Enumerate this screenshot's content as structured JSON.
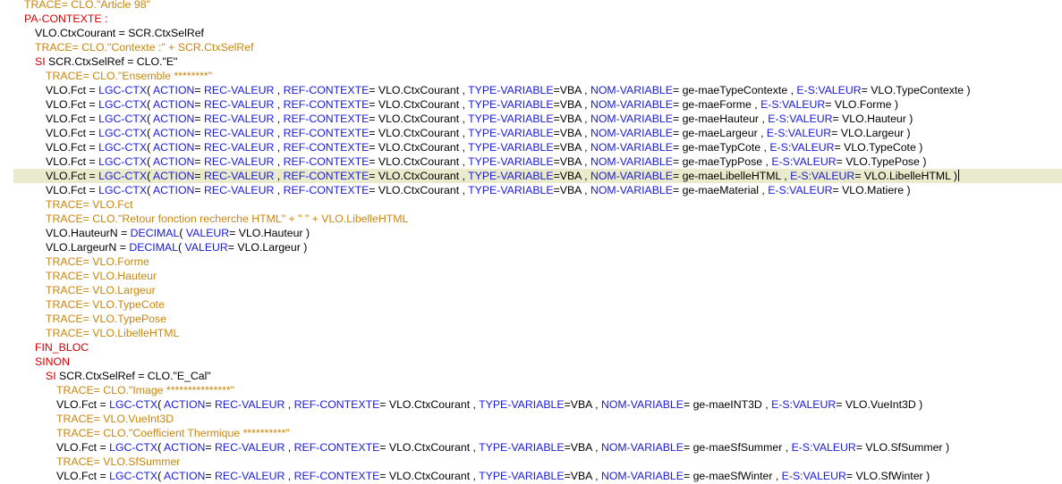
{
  "editor": {
    "current_line_index": 12,
    "lines": [
      {
        "indent": 27,
        "tokens": [
          [
            "tr",
            "TRACE= CLO.\"Article 98\""
          ]
        ]
      },
      {
        "indent": 27,
        "tokens": [
          [
            "rd",
            "PA-CONTEXTE :"
          ]
        ]
      },
      {
        "indent": 39,
        "tokens": [
          [
            "b",
            "VLO.CtxCourant = SCR.CtxSelRef"
          ]
        ]
      },
      {
        "indent": 39,
        "tokens": [
          [
            "tr",
            "TRACE= CLO.\"Contexte :\" + SCR.CtxSelRef"
          ]
        ]
      },
      {
        "indent": 39,
        "tokens": [
          [
            "rd",
            "SI "
          ],
          [
            "b",
            "SCR.CtxSelRef = CLO.\"E\""
          ]
        ]
      },
      {
        "indent": 51,
        "tokens": [
          [
            "tr",
            "TRACE= CLO.\"Ensemble ********\""
          ]
        ]
      },
      {
        "indent": 51,
        "tokens": [
          [
            "b",
            "VLO.Fct = "
          ],
          [
            "fn",
            "LGC-CTX"
          ],
          [
            "b",
            "( "
          ],
          [
            "kw",
            "ACTION"
          ],
          [
            "b",
            "= "
          ],
          [
            "kw",
            "REC-VALEUR"
          ],
          [
            "b",
            " , "
          ],
          [
            "kw",
            "REF-CONTEXTE"
          ],
          [
            "b",
            "= VLO.CtxCourant , "
          ],
          [
            "kw",
            "TYPE-VARIABLE"
          ],
          [
            "b",
            "=VBA , "
          ],
          [
            "kw",
            "NOM-VARIABLE"
          ],
          [
            "b",
            "= ge-maeTypeContexte , "
          ],
          [
            "kw",
            "E-S:VALEUR"
          ],
          [
            "b",
            "= VLO.TypeContexte )"
          ]
        ]
      },
      {
        "indent": 51,
        "tokens": [
          [
            "b",
            "VLO.Fct = "
          ],
          [
            "fn",
            "LGC-CTX"
          ],
          [
            "b",
            "( "
          ],
          [
            "kw",
            "ACTION"
          ],
          [
            "b",
            "= "
          ],
          [
            "kw",
            "REC-VALEUR"
          ],
          [
            "b",
            " , "
          ],
          [
            "kw",
            "REF-CONTEXTE"
          ],
          [
            "b",
            "= VLO.CtxCourant , "
          ],
          [
            "kw",
            "TYPE-VARIABLE"
          ],
          [
            "b",
            "=VBA , "
          ],
          [
            "kw",
            "NOM-VARIABLE"
          ],
          [
            "b",
            "= ge-maeForme , "
          ],
          [
            "kw",
            "E-S:VALEUR"
          ],
          [
            "b",
            "= VLO.Forme )"
          ]
        ]
      },
      {
        "indent": 51,
        "tokens": [
          [
            "b",
            "VLO.Fct = "
          ],
          [
            "fn",
            "LGC-CTX"
          ],
          [
            "b",
            "( "
          ],
          [
            "kw",
            "ACTION"
          ],
          [
            "b",
            "= "
          ],
          [
            "kw",
            "REC-VALEUR"
          ],
          [
            "b",
            " , "
          ],
          [
            "kw",
            "REF-CONTEXTE"
          ],
          [
            "b",
            "= VLO.CtxCourant , "
          ],
          [
            "kw",
            "TYPE-VARIABLE"
          ],
          [
            "b",
            "=VBA , "
          ],
          [
            "kw",
            "NOM-VARIABLE"
          ],
          [
            "b",
            "= ge-maeHauteur , "
          ],
          [
            "kw",
            "E-S:VALEUR"
          ],
          [
            "b",
            "= VLO.Hauteur )"
          ]
        ]
      },
      {
        "indent": 51,
        "tokens": [
          [
            "b",
            "VLO.Fct = "
          ],
          [
            "fn",
            "LGC-CTX"
          ],
          [
            "b",
            "( "
          ],
          [
            "kw",
            "ACTION"
          ],
          [
            "b",
            "= "
          ],
          [
            "kw",
            "REC-VALEUR"
          ],
          [
            "b",
            " , "
          ],
          [
            "kw",
            "REF-CONTEXTE"
          ],
          [
            "b",
            "= VLO.CtxCourant , "
          ],
          [
            "kw",
            "TYPE-VARIABLE"
          ],
          [
            "b",
            "=VBA , "
          ],
          [
            "kw",
            "NOM-VARIABLE"
          ],
          [
            "b",
            "= ge-maeLargeur , "
          ],
          [
            "kw",
            "E-S:VALEUR"
          ],
          [
            "b",
            "= VLO.Largeur )"
          ]
        ]
      },
      {
        "indent": 51,
        "tokens": [
          [
            "b",
            "VLO.Fct = "
          ],
          [
            "fn",
            "LGC-CTX"
          ],
          [
            "b",
            "( "
          ],
          [
            "kw",
            "ACTION"
          ],
          [
            "b",
            "= "
          ],
          [
            "kw",
            "REC-VALEUR"
          ],
          [
            "b",
            " , "
          ],
          [
            "kw",
            "REF-CONTEXTE"
          ],
          [
            "b",
            "= VLO.CtxCourant , "
          ],
          [
            "kw",
            "TYPE-VARIABLE"
          ],
          [
            "b",
            "=VBA , "
          ],
          [
            "kw",
            "NOM-VARIABLE"
          ],
          [
            "b",
            "= ge-maeTypCote , "
          ],
          [
            "kw",
            "E-S:VALEUR"
          ],
          [
            "b",
            "= VLO.TypeCote )"
          ]
        ]
      },
      {
        "indent": 51,
        "tokens": [
          [
            "b",
            "VLO.Fct = "
          ],
          [
            "fn",
            "LGC-CTX"
          ],
          [
            "b",
            "( "
          ],
          [
            "kw",
            "ACTION"
          ],
          [
            "b",
            "= "
          ],
          [
            "kw",
            "REC-VALEUR"
          ],
          [
            "b",
            " , "
          ],
          [
            "kw",
            "REF-CONTEXTE"
          ],
          [
            "b",
            "= VLO.CtxCourant , "
          ],
          [
            "kw",
            "TYPE-VARIABLE"
          ],
          [
            "b",
            "=VBA , "
          ],
          [
            "kw",
            "NOM-VARIABLE"
          ],
          [
            "b",
            "= ge-maeTypPose , "
          ],
          [
            "kw",
            "E-S:VALEUR"
          ],
          [
            "b",
            "= VLO.TypePose )"
          ]
        ]
      },
      {
        "indent": 51,
        "tokens": [
          [
            "b",
            "VLO.Fct = "
          ],
          [
            "fn",
            "LGC-CTX"
          ],
          [
            "b",
            "( "
          ],
          [
            "kw",
            "ACTION"
          ],
          [
            "b",
            "= "
          ],
          [
            "kw",
            "REC-VALEUR"
          ],
          [
            "b",
            " , "
          ],
          [
            "kw",
            "REF-CONTEXTE"
          ],
          [
            "b",
            "= VLO.CtxCourant , "
          ],
          [
            "kw",
            "TYPE-VARIABLE"
          ],
          [
            "b",
            "=VBA , "
          ],
          [
            "kw",
            "NOM-VARIABLE"
          ],
          [
            "b",
            "= ge-maeLibelleHTML , "
          ],
          [
            "kw",
            "E-S:VALEUR"
          ],
          [
            "b",
            "= VLO.LibelleHTML )"
          ]
        ]
      },
      {
        "indent": 51,
        "tokens": [
          [
            "b",
            "VLO.Fct = "
          ],
          [
            "fn",
            "LGC-CTX"
          ],
          [
            "b",
            "( "
          ],
          [
            "kw",
            "ACTION"
          ],
          [
            "b",
            "= "
          ],
          [
            "kw",
            "REC-VALEUR"
          ],
          [
            "b",
            " , "
          ],
          [
            "kw",
            "REF-CONTEXTE"
          ],
          [
            "b",
            "= VLO.CtxCourant , "
          ],
          [
            "kw",
            "TYPE-VARIABLE"
          ],
          [
            "b",
            "=VBA , "
          ],
          [
            "kw",
            "NOM-VARIABLE"
          ],
          [
            "b",
            "= ge-maeMaterial , "
          ],
          [
            "kw",
            "E-S:VALEUR"
          ],
          [
            "b",
            "= VLO.Matiere )"
          ]
        ]
      },
      {
        "indent": 51,
        "tokens": [
          [
            "tr",
            "TRACE= VLO.Fct"
          ]
        ]
      },
      {
        "indent": 51,
        "tokens": [
          [
            "tr",
            "TRACE= CLO.\"Retour fonction recherche HTML\" + \" \" + VLO.LibelleHTML"
          ]
        ]
      },
      {
        "indent": 51,
        "tokens": [
          [
            "b",
            "VLO.HauteurN = "
          ],
          [
            "fn",
            "DECIMAL"
          ],
          [
            "b",
            "( "
          ],
          [
            "kw",
            "VALEUR"
          ],
          [
            "b",
            "= VLO.Hauteur )"
          ]
        ]
      },
      {
        "indent": 51,
        "tokens": [
          [
            "b",
            "VLO.LargeurN = "
          ],
          [
            "fn",
            "DECIMAL"
          ],
          [
            "b",
            "( "
          ],
          [
            "kw",
            "VALEUR"
          ],
          [
            "b",
            "= VLO.Largeur )"
          ]
        ]
      },
      {
        "indent": 51,
        "tokens": [
          [
            "tr",
            "TRACE= VLO.Forme"
          ]
        ]
      },
      {
        "indent": 51,
        "tokens": [
          [
            "tr",
            "TRACE= VLO.Hauteur"
          ]
        ]
      },
      {
        "indent": 51,
        "tokens": [
          [
            "tr",
            "TRACE= VLO.Largeur"
          ]
        ]
      },
      {
        "indent": 51,
        "tokens": [
          [
            "tr",
            "TRACE= VLO.TypeCote"
          ]
        ]
      },
      {
        "indent": 51,
        "tokens": [
          [
            "tr",
            "TRACE= VLO.TypePose"
          ]
        ]
      },
      {
        "indent": 51,
        "tokens": [
          [
            "tr",
            "TRACE= VLO.LibelleHTML"
          ]
        ]
      },
      {
        "indent": 39,
        "tokens": [
          [
            "rd",
            "FIN_BLOC"
          ]
        ]
      },
      {
        "indent": 39,
        "tokens": [
          [
            "rd",
            "SINON"
          ]
        ]
      },
      {
        "indent": 51,
        "tokens": [
          [
            "rd",
            "SI "
          ],
          [
            "b",
            "SCR.CtxSelRef = CLO.\"E_Cal\""
          ]
        ]
      },
      {
        "indent": 63,
        "tokens": [
          [
            "tr",
            "TRACE= CLO.\"Image ***************\""
          ]
        ]
      },
      {
        "indent": 63,
        "tokens": [
          [
            "b",
            "VLO.Fct = "
          ],
          [
            "fn",
            "LGC-CTX"
          ],
          [
            "b",
            "( "
          ],
          [
            "kw",
            "ACTION"
          ],
          [
            "b",
            "= "
          ],
          [
            "kw",
            "REC-VALEUR"
          ],
          [
            "b",
            " , "
          ],
          [
            "kw",
            "REF-CONTEXTE"
          ],
          [
            "b",
            "= VLO.CtxCourant , "
          ],
          [
            "kw",
            "TYPE-VARIABLE"
          ],
          [
            "b",
            "=VBA , "
          ],
          [
            "kw",
            "NOM-VARIABLE"
          ],
          [
            "b",
            "= ge-maeINT3D , "
          ],
          [
            "kw",
            "E-S:VALEUR"
          ],
          [
            "b",
            "= VLO.VueInt3D )"
          ]
        ]
      },
      {
        "indent": 63,
        "tokens": [
          [
            "tr",
            "TRACE= VLO.VueInt3D"
          ]
        ]
      },
      {
        "indent": 63,
        "tokens": [
          [
            "tr",
            "TRACE= CLO.\"Coefficient Thermique **********\""
          ]
        ]
      },
      {
        "indent": 63,
        "tokens": [
          [
            "b",
            "VLO.Fct = "
          ],
          [
            "fn",
            "LGC-CTX"
          ],
          [
            "b",
            "( "
          ],
          [
            "kw",
            "ACTION"
          ],
          [
            "b",
            "= "
          ],
          [
            "kw",
            "REC-VALEUR"
          ],
          [
            "b",
            " , "
          ],
          [
            "kw",
            "REF-CONTEXTE"
          ],
          [
            "b",
            "= VLO.CtxCourant , "
          ],
          [
            "kw",
            "TYPE-VARIABLE"
          ],
          [
            "b",
            "=VBA , "
          ],
          [
            "kw",
            "NOM-VARIABLE"
          ],
          [
            "b",
            "= ge-maeSfSummer , "
          ],
          [
            "kw",
            "E-S:VALEUR"
          ],
          [
            "b",
            "= VLO.SfSummer )"
          ]
        ]
      },
      {
        "indent": 63,
        "tokens": [
          [
            "tr",
            "TRACE= VLO.SfSummer"
          ]
        ]
      },
      {
        "indent": 63,
        "tokens": [
          [
            "b",
            "VLO.Fct = "
          ],
          [
            "fn",
            "LGC-CTX"
          ],
          [
            "b",
            "( "
          ],
          [
            "kw",
            "ACTION"
          ],
          [
            "b",
            "= "
          ],
          [
            "kw",
            "REC-VALEUR"
          ],
          [
            "b",
            " , "
          ],
          [
            "kw",
            "REF-CONTEXTE"
          ],
          [
            "b",
            "= VLO.CtxCourant , "
          ],
          [
            "kw",
            "TYPE-VARIABLE"
          ],
          [
            "b",
            "=VBA , "
          ],
          [
            "kw",
            "NOM-VARIABLE"
          ],
          [
            "b",
            "= ge-maeSfWinter , "
          ],
          [
            "kw",
            "E-S:VALEUR"
          ],
          [
            "b",
            "= VLO.SfWinter )"
          ]
        ]
      }
    ]
  }
}
